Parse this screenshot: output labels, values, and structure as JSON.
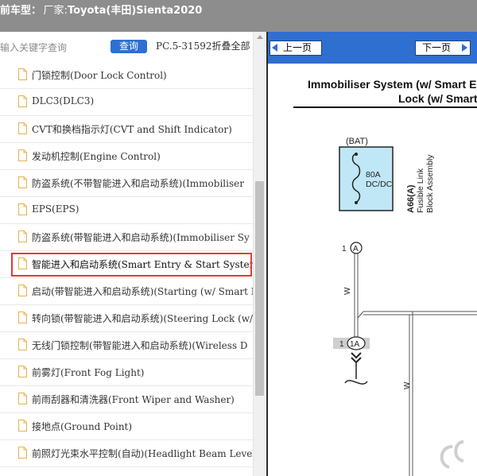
{
  "window": {
    "title_prefix": "前车型：",
    "title_maker_label": "厂家:",
    "title_model": "Toyota(丰田)Sienta2020"
  },
  "search": {
    "placeholder": "输入关键字查询",
    "button_label": "查询",
    "info_text": "PC.5-31592折叠全部"
  },
  "tree": {
    "items": [
      {
        "label": "门锁控制(Door Lock Control)"
      },
      {
        "label": "DLC3(DLC3)"
      },
      {
        "label": "CVT和换档指示灯(CVT and Shift Indicator)"
      },
      {
        "label": "发动机控制(Engine Control)"
      },
      {
        "label": "防盗系统(不带智能进入和启动系统)(Immobiliser"
      },
      {
        "label": "EPS(EPS)"
      },
      {
        "label": "防盗系统(带智能进入和启动系统)(Immobiliser Sy"
      },
      {
        "label": "智能进入和启动系统(Smart Entry & Start System)",
        "selected": true
      },
      {
        "label": "启动(带智能进入和启动系统)(Starting (w/ Smart E"
      },
      {
        "label": "转向锁(带智能进入和启动系统)(Steering Lock (w/"
      },
      {
        "label": "无线门锁控制(带智能进入和启动系统)(Wireless D"
      },
      {
        "label": "前雾灯(Front Fog Light)"
      },
      {
        "label": "前雨刮器和清洗器(Front Wiper and Washer)"
      },
      {
        "label": "接地点(Ground Point)"
      },
      {
        "label": "前照灯光束水平控制(自动)(Headlight Beam Level"
      }
    ]
  },
  "viewer": {
    "prev_label": "上一页",
    "next_label": "下一页",
    "title_line1": "Immobiliser System (w/ Smart E",
    "title_line2": "Lock (w/ Smart",
    "diagram": {
      "bat_label": "(BAT)",
      "fuse_rating": "80A",
      "fuse_type": "DC/DC",
      "fuse_code": "A66(A)",
      "fuse_name_1": "Fusible Link",
      "fuse_name_2": "Block Assembly",
      "pin_1": "1",
      "connector_a": "A",
      "wire_color_1": "W",
      "pin_2": "1",
      "connector_1a": "1A",
      "wire_color_2": "W",
      "fuse_fill": "#bfe7f5"
    }
  },
  "colors": {
    "accent": "#2f6fd0",
    "titlebar": "#8d8d8d",
    "selection": "#e23a3a"
  }
}
